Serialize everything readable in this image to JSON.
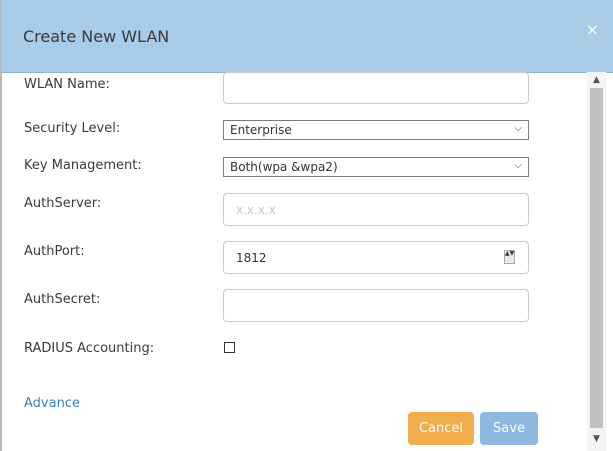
{
  "dialog": {
    "title": "Create New WLAN",
    "close_label": "×"
  },
  "form": {
    "wlan_name": {
      "label": "WLAN Name:",
      "value": "",
      "placeholder": ""
    },
    "security_level": {
      "label": "Security Level:",
      "value": "Enterprise"
    },
    "key_management": {
      "label": "Key Management:",
      "value": "Both(wpa &wpa2)"
    },
    "auth_server": {
      "label": "AuthServer:",
      "value": "",
      "placeholder": "x.x.x.x"
    },
    "auth_port": {
      "label": "AuthPort:",
      "value": "1812"
    },
    "auth_secret": {
      "label": "AuthSecret:",
      "value": "",
      "placeholder": ""
    },
    "radius_accounting": {
      "label": "RADIUS Accounting:",
      "checked": false
    }
  },
  "advance_link": "Advance",
  "buttons": {
    "cancel": "Cancel",
    "save": "Save"
  },
  "icons": {
    "select_chevron": "⌵",
    "spinner": "▲▼",
    "scroll_up": "▲",
    "scroll_down": "▼"
  },
  "colors": {
    "header_bg": "#a8cbe8",
    "cancel_bg": "#f0ad4e",
    "save_bg": "#8fb8e0",
    "link": "#3b7fc0"
  }
}
